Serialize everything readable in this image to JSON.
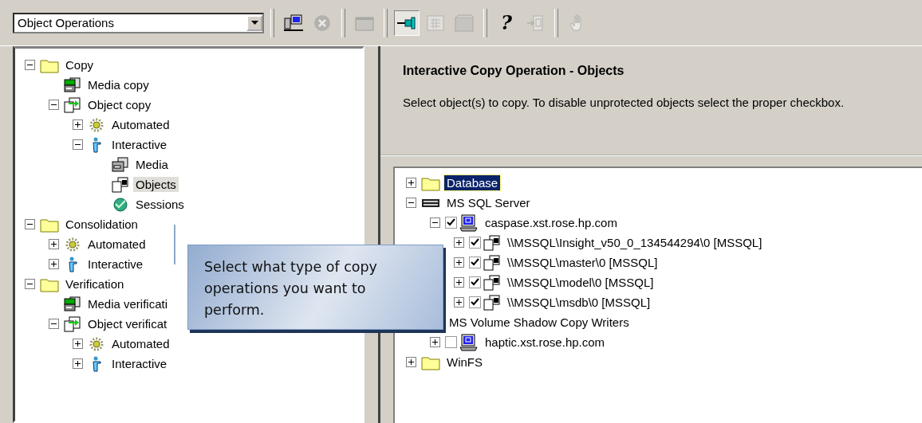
{
  "toolbar": {
    "combo": {
      "value": "Object Operations"
    },
    "buttons": [
      {
        "kind": "computer",
        "pressed": false,
        "disabled": false
      },
      {
        "kind": "cancel",
        "pressed": false,
        "disabled": true
      },
      {
        "kind": "window",
        "pressed": false,
        "disabled": true
      },
      {
        "kind": "pin",
        "pressed": true,
        "disabled": false
      },
      {
        "kind": "grid",
        "pressed": false,
        "disabled": true
      },
      {
        "kind": "film",
        "pressed": false,
        "disabled": true
      },
      {
        "kind": "help",
        "label": "?",
        "pressed": false,
        "disabled": false
      },
      {
        "kind": "import",
        "pressed": false,
        "disabled": true
      },
      {
        "kind": "hand",
        "pressed": false,
        "disabled": true
      }
    ]
  },
  "left_tree": [
    {
      "label": "Copy",
      "kind": "folder",
      "expanded": true,
      "selected": false,
      "children": [
        {
          "label": "Media copy",
          "kind": "media",
          "selected": false
        },
        {
          "label": "Object copy",
          "kind": "object",
          "expanded": true,
          "selected": false,
          "children": [
            {
              "label": "Automated",
              "kind": "gear",
              "expanded": false,
              "selected": false
            },
            {
              "label": "Interactive",
              "kind": "person",
              "expanded": true,
              "selected": false,
              "children": [
                {
                  "label": "Media",
                  "kind": "drive",
                  "selected": false
                },
                {
                  "label": "Objects",
                  "kind": "doc",
                  "selected": true
                },
                {
                  "label": "Sessions",
                  "kind": "sessions",
                  "selected": false
                }
              ]
            }
          ]
        }
      ]
    },
    {
      "label": "Consolidation",
      "kind": "folder",
      "expanded": true,
      "selected": false,
      "children": [
        {
          "label": "Automated",
          "kind": "gear",
          "expanded": false,
          "selected": false
        },
        {
          "label": "Interactive",
          "kind": "person",
          "expanded": false,
          "selected": false
        }
      ]
    },
    {
      "label": "Verification",
      "kind": "folder",
      "expanded": true,
      "selected": false,
      "children": [
        {
          "label": "Media verificati",
          "kind": "media",
          "selected": false
        },
        {
          "label": "Object verificat",
          "kind": "object",
          "expanded": true,
          "selected": false,
          "children": [
            {
              "label": "Automated",
              "kind": "gear",
              "expanded": false,
              "selected": false
            },
            {
              "label": "Interactive",
              "kind": "person",
              "expanded": false,
              "selected": false
            }
          ]
        }
      ]
    }
  ],
  "header": {
    "title": "Interactive Copy Operation - Objects",
    "description": "Select object(s) to copy. To disable unprotected objects select the proper checkbox."
  },
  "right_tree": [
    {
      "label": "Database",
      "kind": "folder",
      "expanded": false,
      "selected": true
    },
    {
      "label": "MS SQL Server",
      "kind": "sql",
      "expanded": true,
      "selected": false,
      "children": [
        {
          "label": "caspase.xst.rose.hp.com",
          "kind": "computer",
          "expanded": true,
          "checked": true,
          "selected": false,
          "children": [
            {
              "label": "\\\\MSSQL\\Insight_v50_0_134544294\\0 [MSSQL]",
              "kind": "doc",
              "expanded": false,
              "checked": true,
              "selected": false
            },
            {
              "label": "\\\\MSSQL\\master\\0 [MSSQL]",
              "kind": "doc",
              "expanded": false,
              "checked": true,
              "selected": false
            },
            {
              "label": "\\\\MSSQL\\model\\0 [MSSQL]",
              "kind": "doc",
              "expanded": false,
              "checked": true,
              "selected": false
            },
            {
              "label": "\\\\MSSQL\\msdb\\0 [MSSQL]",
              "kind": "doc",
              "expanded": false,
              "checked": true,
              "selected": false
            }
          ]
        }
      ]
    },
    {
      "label": "MS Volume Shadow Copy Writers",
      "selected": false,
      "children": [
        {
          "label": "haptic.xst.rose.hp.com",
          "kind": "computer",
          "expanded": false,
          "checked": false,
          "selected": false
        }
      ]
    },
    {
      "label": "WinFS",
      "kind": "folder",
      "expanded": false,
      "selected": false
    }
  ],
  "callout": {
    "text": "Select what type of copy operations you want to perform."
  }
}
